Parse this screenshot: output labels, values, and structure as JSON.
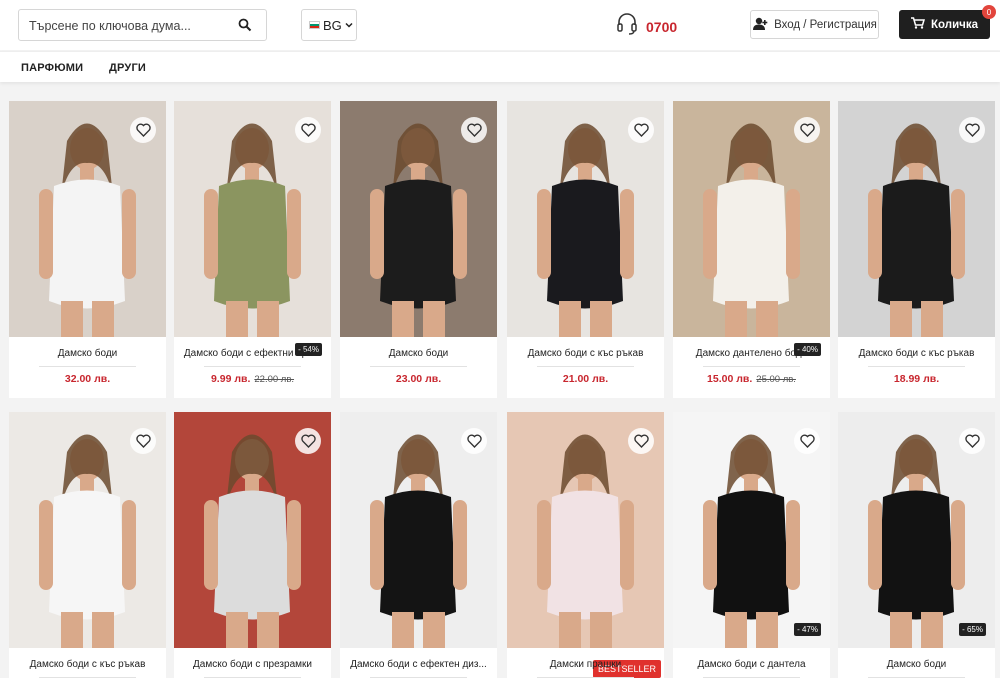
{
  "header": {
    "search_placeholder": "Търсене по ключова дума...",
    "language": "BG",
    "phone": "0700",
    "login_label": "Вход / Регистрация",
    "cart_label": "Количка",
    "cart_count": "0"
  },
  "nav": {
    "items": [
      "ПАРФЮМИ",
      "ДРУГИ"
    ]
  },
  "products": [
    {
      "name": "Дамско боди",
      "price": "32.00 лв.",
      "old_price": "",
      "discount": "",
      "badge": "",
      "bg": "#d9d1c9",
      "dress": "#f4f4f4"
    },
    {
      "name": "Дамско боди с ефектни пре...",
      "price": "9.99 лв.",
      "old_price": "22.00 лв.",
      "discount": "- 54%",
      "badge": "",
      "bg": "#e6e0da",
      "dress": "#8b9560"
    },
    {
      "name": "Дамско боди",
      "price": "23.00 лв.",
      "old_price": "",
      "discount": "",
      "badge": "",
      "bg": "#8c7b6e",
      "dress": "#1c1c1c"
    },
    {
      "name": "Дамско боди с къс ръкав",
      "price": "21.00 лв.",
      "old_price": "",
      "discount": "",
      "badge": "",
      "bg": "#e7e4e0",
      "dress": "#1a1a1e"
    },
    {
      "name": "Дамско дантелено боди",
      "price": "15.00 лв.",
      "old_price": "25.00 лв.",
      "discount": "- 40%",
      "badge": "",
      "bg": "#c9b59c",
      "dress": "#f3f0ea"
    },
    {
      "name": "Дамско боди с къс ръкав",
      "price": "18.99 лв.",
      "old_price": "",
      "discount": "",
      "badge": "",
      "bg": "#d3d3d3",
      "dress": "#1b1b1b"
    },
    {
      "name": "Дамско боди с къс ръкав",
      "price": "",
      "old_price": "",
      "discount": "",
      "badge": "",
      "bg": "#ece9e5",
      "dress": "#f6f6f6"
    },
    {
      "name": "Дамско боди с презрамки",
      "price": "",
      "old_price": "",
      "discount": "",
      "badge": "",
      "bg": "#b3463a",
      "dress": "#dcdcdc"
    },
    {
      "name": "Дамско боди с ефектен диз...",
      "price": "",
      "old_price": "",
      "discount": "",
      "badge": "",
      "bg": "#eeeeee",
      "dress": "#141414"
    },
    {
      "name": "Дамски прашки",
      "price": "",
      "old_price": "",
      "discount": "",
      "badge": "BESTSELLER",
      "bg": "#e6c7b4",
      "dress": "#f1e2e4"
    },
    {
      "name": "Дамско боди с дантела",
      "price": "",
      "old_price": "",
      "discount": "- 47%",
      "badge": "",
      "bg": "#f5f5f5",
      "dress": "#111111"
    },
    {
      "name": "Дамско боди",
      "price": "",
      "old_price": "",
      "discount": "- 65%",
      "badge": "",
      "bg": "#ededed",
      "dress": "#121212"
    }
  ],
  "colors": {
    "accent_red": "#c8262e",
    "cart_bg": "#1f1f1f",
    "badge_red": "#e0312d"
  }
}
